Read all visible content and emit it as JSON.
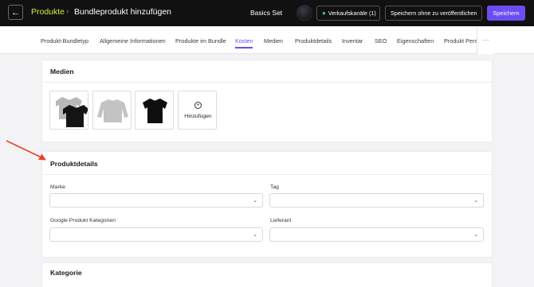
{
  "header": {
    "back_icon": "arrow-left-icon",
    "breadcrumb_link": "Produkte",
    "breadcrumb_separator": "›",
    "breadcrumb_current": "Bundleprodukt hinzufügen",
    "set_name": "Basics Set",
    "sales_channels_label": "Verkaufskanäle (1)",
    "save_unpublished_label": "Speichern ohne zu veröffentlichen",
    "save_label": "Speichern",
    "status_dot_color": "#36d06b",
    "accent_color": "#6c4cf3"
  },
  "tabs": {
    "items": [
      "Produkt-Bundletyp",
      "Allgemeine Informationen",
      "Produkte im Bundle",
      "Kosten",
      "Medien",
      "Produktdetails",
      "Inventar",
      "SEO",
      "Eigenschaften",
      "Produkt Pers"
    ],
    "active": "Kosten",
    "more_label": "···"
  },
  "media": {
    "title": "Medien",
    "thumbnails": [
      "tshirt-set-grey-black-image",
      "sweatshirt-grey-image",
      "tshirt-black-image"
    ],
    "add_label": "Hinzufügen",
    "add_icon": "plus-circle-icon"
  },
  "details": {
    "title": "Produktdetails",
    "fields": {
      "brand_label": "Marke",
      "tag_label": "Tag",
      "google_category_label": "Google Produkt Kategorien",
      "supplier_label": "Lieferant"
    },
    "chevron": "⌄"
  },
  "category": {
    "title": "Kategorie"
  }
}
